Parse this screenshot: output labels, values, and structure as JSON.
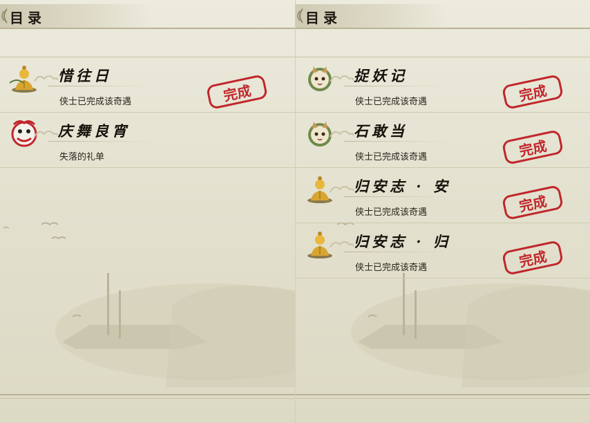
{
  "left_page": {
    "header_title": "目录",
    "entries": [
      {
        "title": "惜往日",
        "subtitle": "侠士已完成该奇遇",
        "icon": "buddha-statue-icon",
        "completed": true
      },
      {
        "title": "庆舞良宵",
        "subtitle": "失落的礼单",
        "icon": "lion-dance-icon",
        "completed": false
      }
    ]
  },
  "right_page": {
    "header_title": "目录",
    "entries": [
      {
        "title": "捉妖记",
        "subtitle": "侠士已完成该奇遇",
        "icon": "fox-spirit-icon",
        "completed": true
      },
      {
        "title": "石敢当",
        "subtitle": "侠士已完成该奇遇",
        "icon": "fox-spirit-icon",
        "completed": true
      },
      {
        "title": "归安志 · 安",
        "subtitle": "侠士已完成该奇遇",
        "icon": "buddha-statue-icon",
        "completed": true
      },
      {
        "title": "归安志 · 归",
        "subtitle": "侠士已完成该奇遇",
        "icon": "buddha-statue-icon",
        "completed": true
      }
    ]
  },
  "stamp_text": "完成",
  "colors": {
    "stamp_red": "#c0262b",
    "ink": "#15120c",
    "paper": "#e6e3d1"
  }
}
